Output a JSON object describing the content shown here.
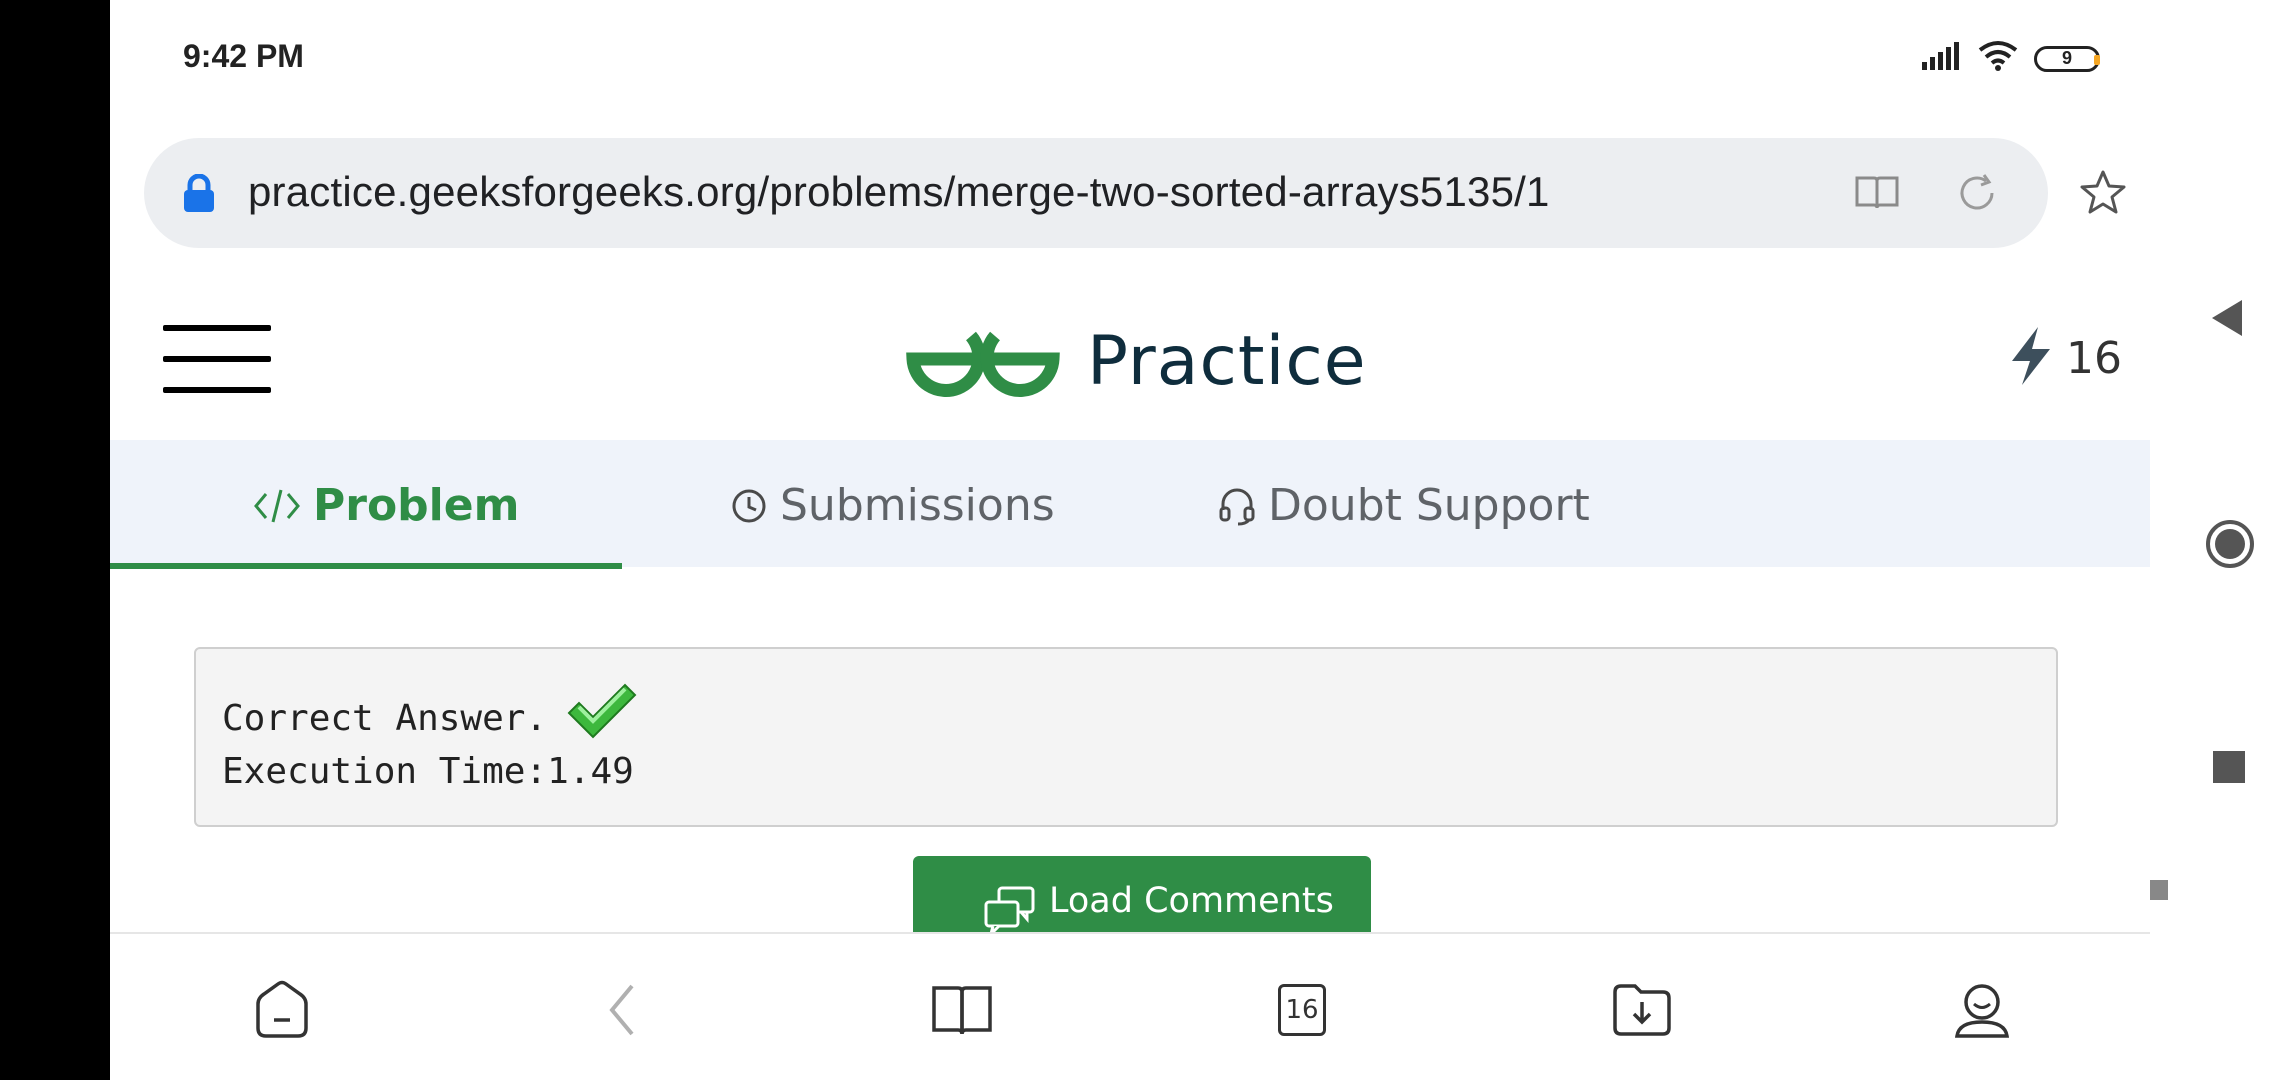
{
  "status_bar": {
    "time": "9:42 PM",
    "battery": "9"
  },
  "browser": {
    "url": "practice.geeksforgeeks.org/problems/merge-two-sorted-arrays5135/1",
    "icons": [
      "lock-icon",
      "reader-mode-icon",
      "reload-icon",
      "bookmark-star-icon"
    ]
  },
  "header": {
    "logo_text": "Practice",
    "streak_count": "16"
  },
  "tabs": [
    {
      "label": "Problem",
      "icon": "code-icon",
      "active": true
    },
    {
      "label": "Submissions",
      "icon": "clock-icon",
      "active": false
    },
    {
      "label": "Doubt Support",
      "icon": "headset-icon",
      "active": false
    }
  ],
  "result": {
    "line1": "Correct Answer.",
    "line2": "Execution Time:1.49"
  },
  "load_comments": {
    "label": "Load Comments"
  },
  "bottom_nav": {
    "tab_count": "16",
    "items": [
      "home-icon",
      "back-icon",
      "bookmarks-icon",
      "tabs-icon",
      "downloads-icon",
      "profile-icon"
    ]
  },
  "colors": {
    "accent": "#2f8d46",
    "tab_bg": "#eff3fa",
    "url_bg": "#eceef1"
  }
}
